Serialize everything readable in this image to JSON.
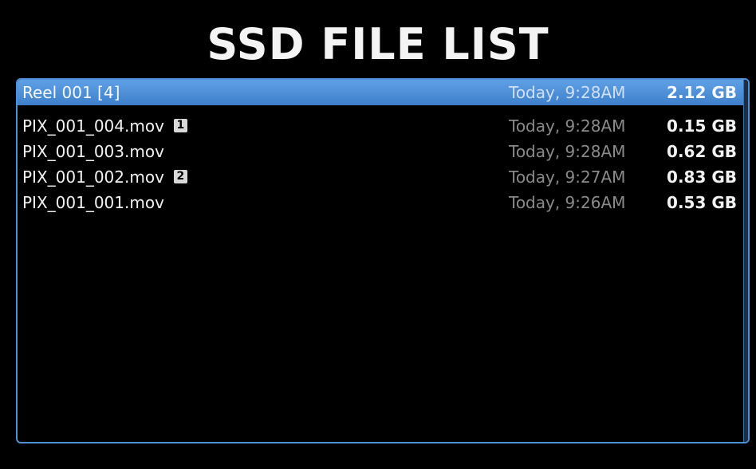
{
  "title": "SSD FILE LIST",
  "colors": {
    "background": "#000000",
    "selection": "#4f8fd6",
    "date_text": "#8a8a8a"
  },
  "list": {
    "selected_index": 0,
    "rows": [
      {
        "name": "Reel 001 [4]",
        "badge": "",
        "date": "Today, 9:28AM",
        "size": "2.12 GB"
      },
      {
        "name": "PIX_001_004.mov",
        "badge": "1",
        "date": "Today, 9:28AM",
        "size": "0.15 GB"
      },
      {
        "name": "PIX_001_003.mov",
        "badge": "",
        "date": "Today, 9:28AM",
        "size": "0.62 GB"
      },
      {
        "name": "PIX_001_002.mov",
        "badge": "2",
        "date": "Today, 9:27AM",
        "size": "0.83 GB"
      },
      {
        "name": "PIX_001_001.mov",
        "badge": "",
        "date": "Today, 9:26AM",
        "size": "0.53 GB"
      }
    ]
  }
}
